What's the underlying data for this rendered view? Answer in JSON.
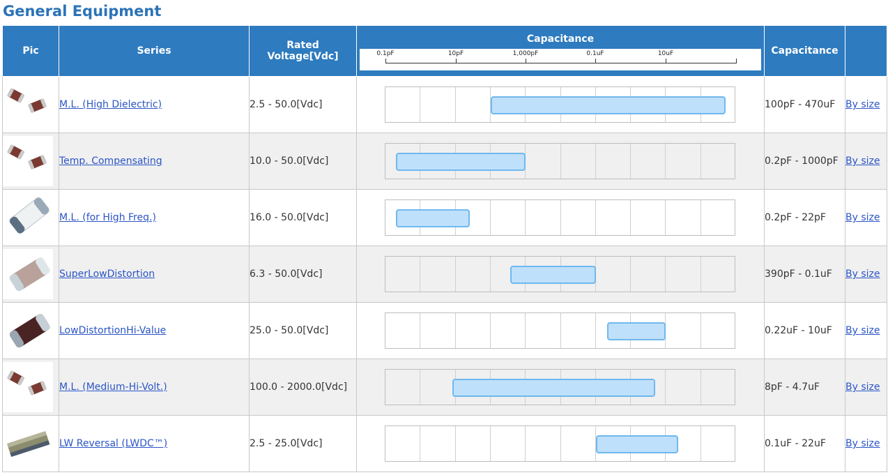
{
  "page_title": "General Equipment",
  "headers": {
    "pic": "Pic",
    "series": "Series",
    "voltage": "Rated Voltage[Vdc]",
    "capacitance_range": "Capacitance",
    "capacitance": "Capacitance",
    "size": ""
  },
  "scale_labels": [
    "0.1pF",
    "10pF",
    "1,000pF",
    "0.1uF",
    "10uF"
  ],
  "rows": [
    {
      "series": "M.L. (High Dielectric)",
      "voltage": "2.5 - 50.0[Vdc]",
      "capacitance": "100pF - 470uF",
      "size_link": "By size",
      "range_fraction": [
        0.3,
        0.97
      ],
      "icon": "mlcc-chip-pair-icon"
    },
    {
      "series": "Temp. Compensating",
      "voltage": "10.0 - 50.0[Vdc]",
      "capacitance": "0.2pF - 1000pF",
      "size_link": "By size",
      "range_fraction": [
        0.03,
        0.4
      ],
      "icon": "mlcc-chip-pair-icon"
    },
    {
      "series": "M.L. (for High Freq.)",
      "voltage": "16.0 - 50.0[Vdc]",
      "capacitance": "0.2pF - 22pF",
      "size_link": "By size",
      "range_fraction": [
        0.03,
        0.24
      ],
      "icon": "white-chip-icon"
    },
    {
      "series": "SuperLowDistortion",
      "voltage": "6.3 - 50.0[Vdc]",
      "capacitance": "390pF - 0.1uF",
      "size_link": "By size",
      "range_fraction": [
        0.356,
        0.6
      ],
      "icon": "beige-chip-icon"
    },
    {
      "series": "LowDistortionHi-Value",
      "voltage": "25.0 - 50.0[Vdc]",
      "capacitance": "0.22uF - 10uF",
      "size_link": "By size",
      "range_fraction": [
        0.633,
        0.8
      ],
      "icon": "brown-chip-icon"
    },
    {
      "series": "M.L. (Medium-Hi-Volt.)",
      "voltage": "100.0 - 2000.0[Vdc]",
      "capacitance": "8pF - 4.7uF",
      "size_link": "By size",
      "range_fraction": [
        0.19,
        0.77
      ],
      "icon": "mlcc-chip-pair-icon"
    },
    {
      "series": "LW Reversal (LWDC™)",
      "voltage": "2.5 - 25.0[Vdc]",
      "capacitance": "0.1uF - 22uF",
      "size_link": "By size",
      "range_fraction": [
        0.6,
        0.835
      ],
      "icon": "lw-reversal-chip-icon"
    }
  ],
  "colors": {
    "header_bg": "#2e7bbf",
    "title": "#2b73b8",
    "bar_fill": "#bfe0fb",
    "bar_border": "#6fb8ee",
    "link": "#2b55c7"
  }
}
